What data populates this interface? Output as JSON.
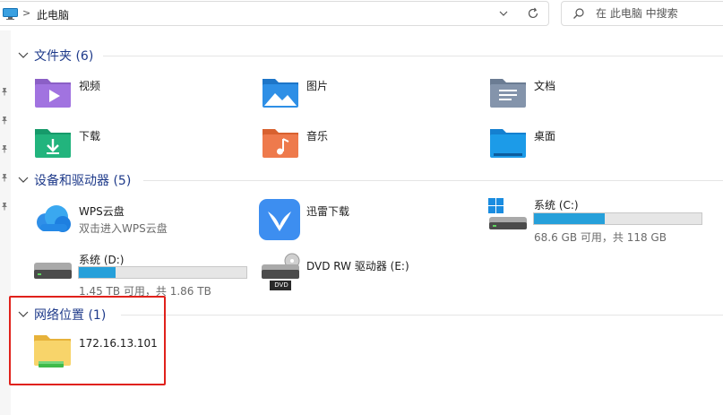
{
  "address": {
    "crumb_sep": ">",
    "path": "此电脑",
    "search_placeholder": "在 此电脑 中搜索"
  },
  "groups": {
    "folders": {
      "title": "文件夹 (6)",
      "items": [
        {
          "label": "视频",
          "icon": "videos-folder-icon"
        },
        {
          "label": "图片",
          "icon": "pictures-folder-icon"
        },
        {
          "label": "文档",
          "icon": "documents-folder-icon"
        },
        {
          "label": "下载",
          "icon": "downloads-folder-icon"
        },
        {
          "label": "音乐",
          "icon": "music-folder-icon"
        },
        {
          "label": "桌面",
          "icon": "desktop-folder-icon"
        }
      ]
    },
    "drives": {
      "title": "设备和驱动器 (5)",
      "items": [
        {
          "label": "WPS云盘",
          "sub": "双击进入WPS云盘",
          "icon": "wps-cloud-icon"
        },
        {
          "label": "迅雷下载",
          "icon": "thunder-download-icon"
        },
        {
          "label": "系统 (C:)",
          "sub": "68.6 GB 可用，共 118 GB",
          "used_fraction": 0.42,
          "icon": "windows-drive-icon"
        },
        {
          "label": "系统 (D:)",
          "sub": "1.45 TB 可用，共 1.86 TB",
          "used_fraction": 0.22,
          "icon": "hard-drive-icon"
        },
        {
          "label": "DVD RW 驱动器 (E:)",
          "badge": "DVD",
          "icon": "dvd-drive-icon"
        }
      ]
    },
    "network": {
      "title": "网络位置 (1)",
      "items": [
        {
          "label": "172.16.13.101",
          "icon": "network-folder-icon"
        }
      ]
    }
  },
  "colors": {
    "accent": "#26a0da",
    "group_title": "#1e3a8a",
    "highlight_box": "#e0211b"
  }
}
